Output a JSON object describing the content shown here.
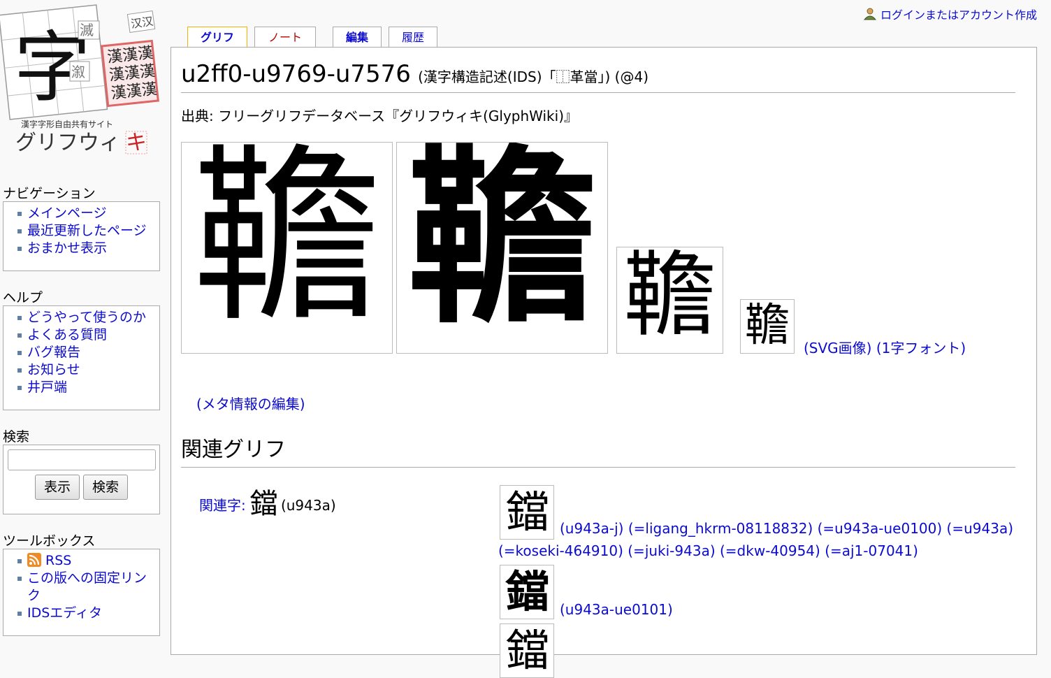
{
  "logo": {
    "big_char": "字",
    "small_chars": [
      "漢",
      "汉",
      "漢",
      "漢",
      "漢",
      "漢",
      "漢",
      "漢"
    ],
    "tag_top": "汉汉",
    "tagline": "漢字字形自由共有サイト",
    "name_main": "グリフウィ",
    "name_last": "キ"
  },
  "personal": {
    "login": "ログインまたはアカウント作成"
  },
  "tabs": [
    {
      "label": "グリフ"
    },
    {
      "label": "ノート"
    },
    {
      "label": "編集"
    },
    {
      "label": "履歴"
    }
  ],
  "heading": {
    "title": "u2ff0-u9769-u7576",
    "subtitle": "(漢字構造記述(IDS)「⿰革當」) (@4)"
  },
  "site_sub": "出典: フリーグリフデータベース『グリフウィキ(GlyphWiki)』",
  "main_glyph": "韂",
  "svg_links": "(SVG画像) (1字フォント)",
  "meta_edit": "(メタ情報の編集)",
  "related_heading": "関連グリフ",
  "related": {
    "label": "関連字:",
    "char": "鐺",
    "code": "(u943a)"
  },
  "variants": [
    {
      "glyph": "鐺",
      "line1": "(u943a-j) (=ligang_hkrm-08118832) (=u943a-ue0100) (=u943a)",
      "line2": "(=koseki-464910) (=juki-943a) (=dkw-40954) (=aj1-07041)"
    },
    {
      "glyph": "鐺",
      "line1": "(u943a-ue0101)"
    },
    {
      "glyph": "鐺"
    }
  ],
  "sidebar": {
    "navigation": {
      "title": "ナビゲーション",
      "items": [
        "メインページ",
        "最近更新したページ",
        "おまかせ表示"
      ]
    },
    "help": {
      "title": "ヘルプ",
      "items": [
        "どうやって使うのか",
        "よくある質問",
        "バグ報告",
        "お知らせ",
        "井戸端"
      ]
    },
    "search": {
      "title": "検索",
      "go": "表示",
      "search": "検索"
    },
    "toolbox": {
      "title": "ツールボックス",
      "items": [
        "RSS",
        "この版への固定リンク",
        "IDSエディタ"
      ]
    }
  }
}
